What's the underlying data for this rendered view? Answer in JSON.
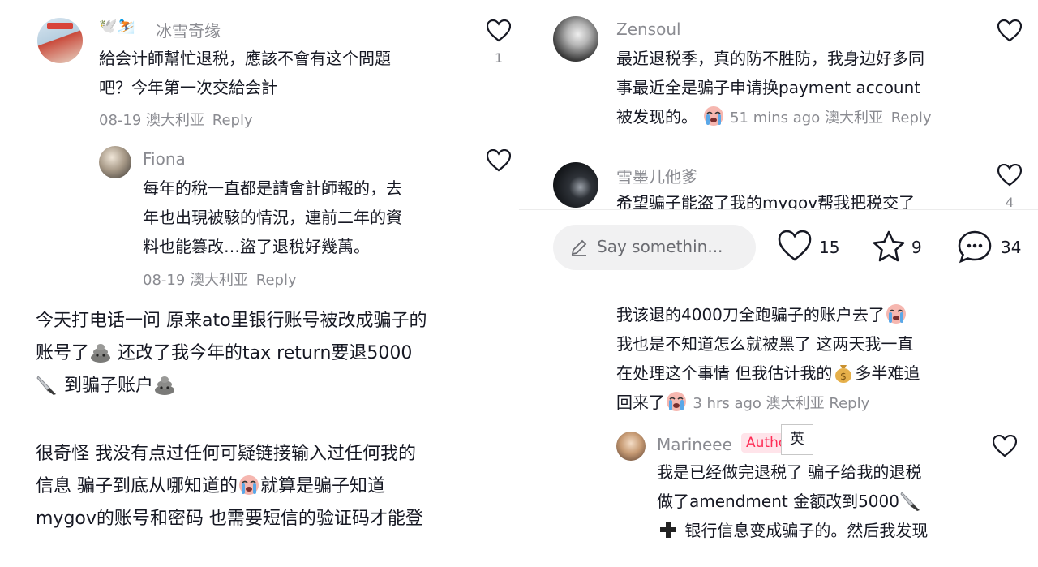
{
  "left": {
    "comment1": {
      "username": "冰雪奇缘",
      "username_prefix_emojis": "🕊️⛷️",
      "text_line1": "給会计師幫忙退税，應該不會有这个問題",
      "text_line2": "吧？今年第一次交給会計",
      "date": "08-19",
      "location": "澳大利亚",
      "reply": "Reply",
      "likes": "1"
    },
    "reply1": {
      "username": "Fiona",
      "text_line1": "每年的稅一直都是請會計師報的，去",
      "text_line2": "年也出現被駭的情況，連前二年的資",
      "text_line3": "料也能篡改…盜了退稅好幾萬。",
      "date": "08-19",
      "location": "澳大利亚",
      "reply": "Reply"
    },
    "post": {
      "line1": "今天打电话一问 原来ato里银行账号被改成骗子的",
      "line2_a": "账号了",
      "line2_b": "还改了我今年的tax return要退5000",
      "line3": "到骗子账户",
      "line4": "很奇怪 我没有点过任何可疑链接输入过任何我的",
      "line5_a": "信息 骗子到底从哪知道的",
      "line5_b": "就算是骗子知道",
      "line6": "mygov的账号和密码 也需要短信的验证码才能登"
    }
  },
  "right": {
    "comment1": {
      "username": "Zensoul",
      "text_line1": "最近退税季，真的防不胜防，我身边好多同",
      "text_line2": "事最近全是骗子申请换payment account",
      "text_line3": "被发现的。",
      "time": "51 mins ago",
      "location": "澳大利亚",
      "reply": "Reply"
    },
    "comment2": {
      "username": "雪墨儿他爹",
      "text_line1": "希望骗子能盗了我的mygov帮我把税交了",
      "likes": "4"
    },
    "bar": {
      "placeholder": "Say somethin...",
      "likes": "15",
      "favorites": "9",
      "comments": "34"
    },
    "comment3": {
      "line1": "我该退的4000刀全跑骗子的账户去了",
      "line2": "我也是不知道怎么就被黑了 这两天我一直",
      "line3_a": "在处理这个事情 但我估计我的",
      "line3_b": "多半难追",
      "line4": "回来了",
      "time": "3 hrs ago",
      "location": "澳大利亚",
      "reply": "Reply"
    },
    "reply1": {
      "username": "Marineee",
      "author_badge": "Autho",
      "translate_button": "英",
      "text_line1": "我是已经做完退税了 骗子给我的退税",
      "text_line2": "做了amendment 金额改到5000",
      "text_line3": "银行信息变成骗子的。然后我发现"
    }
  },
  "colors": {
    "text": "#161823",
    "secondary": "#8a8b91",
    "author_red": "#fe2c55",
    "input_bg": "#f1f1f2"
  },
  "icons": [
    "heart-icon",
    "star-icon",
    "comment-icon",
    "pencil-icon",
    "knife-emoji",
    "moneybag-emoji",
    "crying-emoji",
    "poop-emoji",
    "plus-emoji"
  ]
}
